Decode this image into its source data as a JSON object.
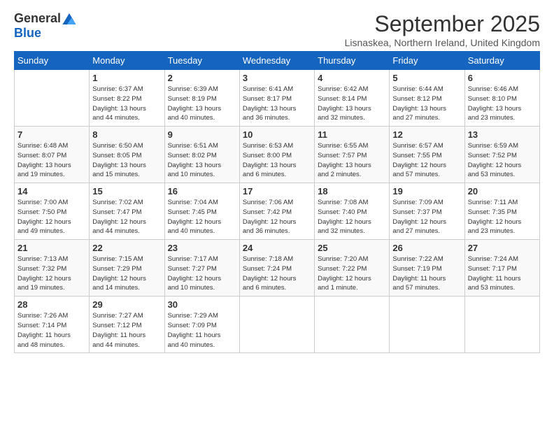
{
  "logo": {
    "general": "General",
    "blue": "Blue"
  },
  "title": "September 2025",
  "location": "Lisnaskea, Northern Ireland, United Kingdom",
  "days_of_week": [
    "Sunday",
    "Monday",
    "Tuesday",
    "Wednesday",
    "Thursday",
    "Friday",
    "Saturday"
  ],
  "weeks": [
    [
      {
        "num": "",
        "info": ""
      },
      {
        "num": "1",
        "info": "Sunrise: 6:37 AM\nSunset: 8:22 PM\nDaylight: 13 hours\nand 44 minutes."
      },
      {
        "num": "2",
        "info": "Sunrise: 6:39 AM\nSunset: 8:19 PM\nDaylight: 13 hours\nand 40 minutes."
      },
      {
        "num": "3",
        "info": "Sunrise: 6:41 AM\nSunset: 8:17 PM\nDaylight: 13 hours\nand 36 minutes."
      },
      {
        "num": "4",
        "info": "Sunrise: 6:42 AM\nSunset: 8:14 PM\nDaylight: 13 hours\nand 32 minutes."
      },
      {
        "num": "5",
        "info": "Sunrise: 6:44 AM\nSunset: 8:12 PM\nDaylight: 13 hours\nand 27 minutes."
      },
      {
        "num": "6",
        "info": "Sunrise: 6:46 AM\nSunset: 8:10 PM\nDaylight: 13 hours\nand 23 minutes."
      }
    ],
    [
      {
        "num": "7",
        "info": "Sunrise: 6:48 AM\nSunset: 8:07 PM\nDaylight: 13 hours\nand 19 minutes."
      },
      {
        "num": "8",
        "info": "Sunrise: 6:50 AM\nSunset: 8:05 PM\nDaylight: 13 hours\nand 15 minutes."
      },
      {
        "num": "9",
        "info": "Sunrise: 6:51 AM\nSunset: 8:02 PM\nDaylight: 13 hours\nand 10 minutes."
      },
      {
        "num": "10",
        "info": "Sunrise: 6:53 AM\nSunset: 8:00 PM\nDaylight: 13 hours\nand 6 minutes."
      },
      {
        "num": "11",
        "info": "Sunrise: 6:55 AM\nSunset: 7:57 PM\nDaylight: 13 hours\nand 2 minutes."
      },
      {
        "num": "12",
        "info": "Sunrise: 6:57 AM\nSunset: 7:55 PM\nDaylight: 12 hours\nand 57 minutes."
      },
      {
        "num": "13",
        "info": "Sunrise: 6:59 AM\nSunset: 7:52 PM\nDaylight: 12 hours\nand 53 minutes."
      }
    ],
    [
      {
        "num": "14",
        "info": "Sunrise: 7:00 AM\nSunset: 7:50 PM\nDaylight: 12 hours\nand 49 minutes."
      },
      {
        "num": "15",
        "info": "Sunrise: 7:02 AM\nSunset: 7:47 PM\nDaylight: 12 hours\nand 44 minutes."
      },
      {
        "num": "16",
        "info": "Sunrise: 7:04 AM\nSunset: 7:45 PM\nDaylight: 12 hours\nand 40 minutes."
      },
      {
        "num": "17",
        "info": "Sunrise: 7:06 AM\nSunset: 7:42 PM\nDaylight: 12 hours\nand 36 minutes."
      },
      {
        "num": "18",
        "info": "Sunrise: 7:08 AM\nSunset: 7:40 PM\nDaylight: 12 hours\nand 32 minutes."
      },
      {
        "num": "19",
        "info": "Sunrise: 7:09 AM\nSunset: 7:37 PM\nDaylight: 12 hours\nand 27 minutes."
      },
      {
        "num": "20",
        "info": "Sunrise: 7:11 AM\nSunset: 7:35 PM\nDaylight: 12 hours\nand 23 minutes."
      }
    ],
    [
      {
        "num": "21",
        "info": "Sunrise: 7:13 AM\nSunset: 7:32 PM\nDaylight: 12 hours\nand 19 minutes."
      },
      {
        "num": "22",
        "info": "Sunrise: 7:15 AM\nSunset: 7:29 PM\nDaylight: 12 hours\nand 14 minutes."
      },
      {
        "num": "23",
        "info": "Sunrise: 7:17 AM\nSunset: 7:27 PM\nDaylight: 12 hours\nand 10 minutes."
      },
      {
        "num": "24",
        "info": "Sunrise: 7:18 AM\nSunset: 7:24 PM\nDaylight: 12 hours\nand 6 minutes."
      },
      {
        "num": "25",
        "info": "Sunrise: 7:20 AM\nSunset: 7:22 PM\nDaylight: 12 hours\nand 1 minute."
      },
      {
        "num": "26",
        "info": "Sunrise: 7:22 AM\nSunset: 7:19 PM\nDaylight: 11 hours\nand 57 minutes."
      },
      {
        "num": "27",
        "info": "Sunrise: 7:24 AM\nSunset: 7:17 PM\nDaylight: 11 hours\nand 53 minutes."
      }
    ],
    [
      {
        "num": "28",
        "info": "Sunrise: 7:26 AM\nSunset: 7:14 PM\nDaylight: 11 hours\nand 48 minutes."
      },
      {
        "num": "29",
        "info": "Sunrise: 7:27 AM\nSunset: 7:12 PM\nDaylight: 11 hours\nand 44 minutes."
      },
      {
        "num": "30",
        "info": "Sunrise: 7:29 AM\nSunset: 7:09 PM\nDaylight: 11 hours\nand 40 minutes."
      },
      {
        "num": "",
        "info": ""
      },
      {
        "num": "",
        "info": ""
      },
      {
        "num": "",
        "info": ""
      },
      {
        "num": "",
        "info": ""
      }
    ]
  ]
}
